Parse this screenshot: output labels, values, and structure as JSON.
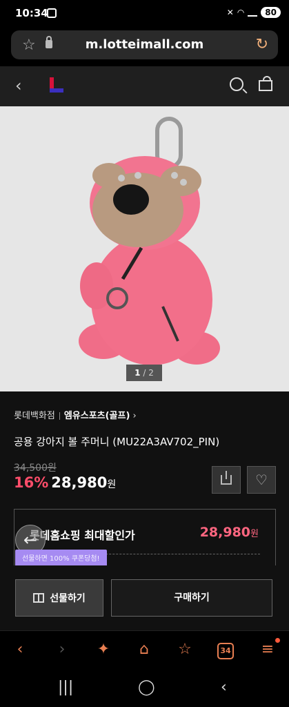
{
  "status": {
    "time": "10:34",
    "battery": "80"
  },
  "browser": {
    "url": "m.lotteimall.com"
  },
  "product": {
    "image_counter": {
      "current": "1",
      "total": "/ 2"
    },
    "brand": "롯데백화점",
    "sub_brand": "엠유스포츠(골프)",
    "name": "공용 강아지 볼 주머니 (MU22A3AV702_PIN)",
    "original_price": "34,500원",
    "discount": "16%",
    "price": "28,980",
    "currency": "원"
  },
  "coupon": {
    "label": "롯데홈쇼핑 최대할인가",
    "price": "28,980",
    "currency": "원",
    "tooltip": "선물하면 100% 쿠폰당첨!"
  },
  "actions": {
    "gift_label": "선물하기",
    "buy_label": "구매하기"
  },
  "toolbar": {
    "tabs_count": "34"
  },
  "colors": {
    "accent": "#ff4d6a",
    "toolbar_accent": "#e97f52",
    "tooltip": "#a68bf2",
    "product_pink": "#f26f8a"
  }
}
